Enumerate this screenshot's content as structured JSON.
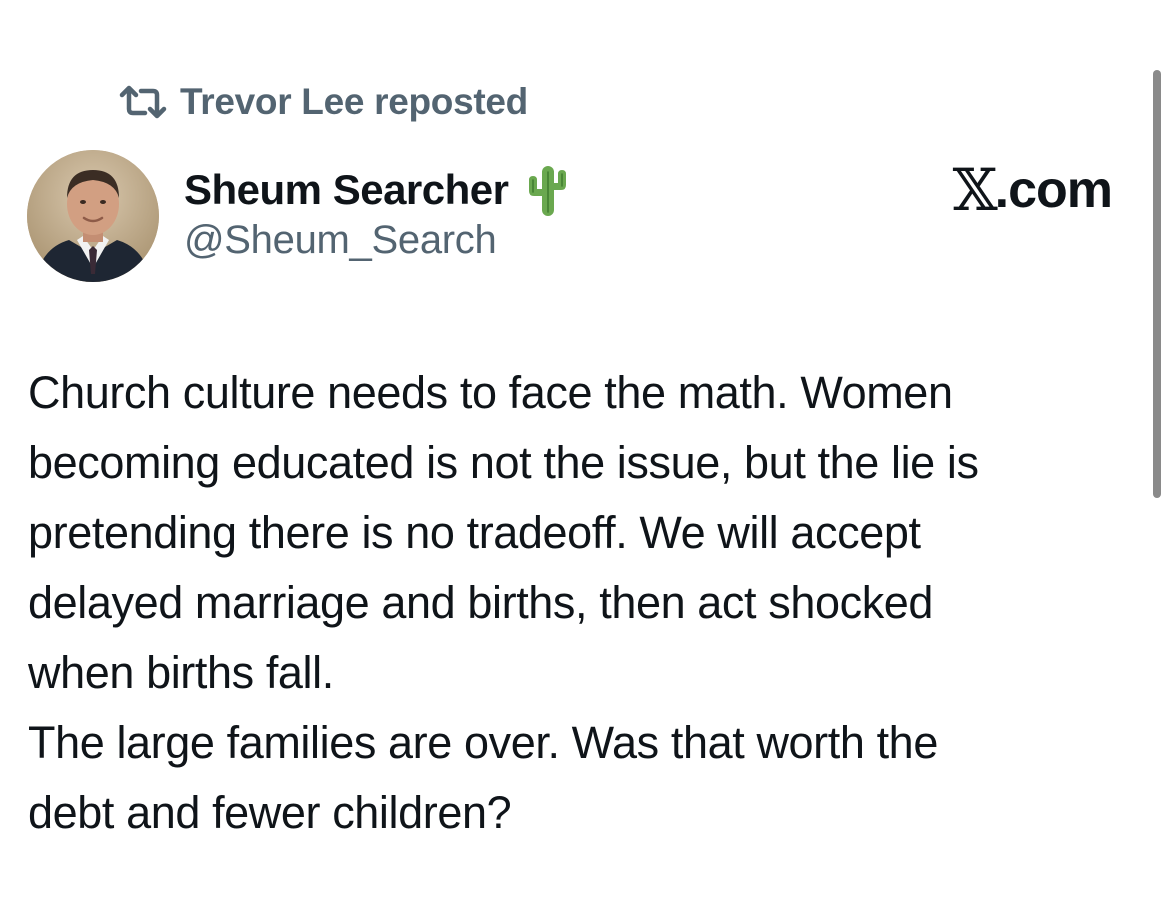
{
  "repost": {
    "icon": "repost-icon",
    "text": "Trevor Lee reposted"
  },
  "author": {
    "avatar": "avatar",
    "display_name": "Sheum Searcher",
    "emoji": "cactus-icon",
    "handle": "@Sheum_Search"
  },
  "brand": {
    "x_glyph": "𝕏",
    "suffix": ".com"
  },
  "tweet": {
    "lines": [
      "Church culture needs to face the math. Women",
      "becoming educated is not the issue, but the lie is",
      "pretending there is no tradeoff. We will accept",
      "delayed marriage and births, then act shocked",
      "when births fall.",
      "The large families are over. Was that worth the",
      "debt and fewer children?"
    ]
  },
  "colors": {
    "text": "#0f1419",
    "secondary": "#536471",
    "cactus": "#6aa84f",
    "scrollbar": "#8a8a8a"
  }
}
